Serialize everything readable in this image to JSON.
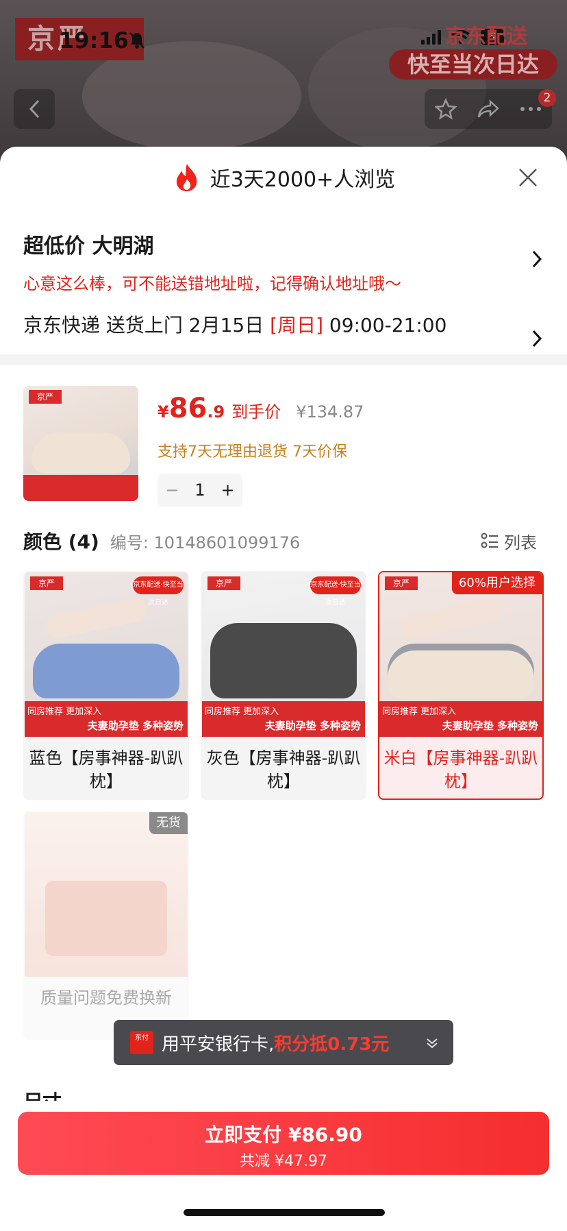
{
  "status_bar": {
    "time": "19:16",
    "battery": "5"
  },
  "header": {
    "brand_logo": "京严",
    "delivery_badge": {
      "line1": "京东配送",
      "line2": "快至当次日达"
    },
    "notification_count": "2"
  },
  "sheet": {
    "title": "近3天2000+人浏览",
    "address": {
      "name": "超低价  大明湖",
      "warning": "心意这么棒，可不能送错地址啦，记得确认地址哦～",
      "delivery_prefix": "京东快递 送货上门 2月15日 ",
      "delivery_day": "[周日]",
      "delivery_time": " 09:00-21:00"
    },
    "product": {
      "currency": "¥",
      "price_int": "86",
      "price_dec": ".9",
      "price_label": "到手价",
      "original_price": "¥134.87",
      "service": "支持7天无理由退货   7天价保",
      "quantity": "1"
    },
    "color_section": {
      "title": "颜色 (4)",
      "code": "编号: 10148601099176",
      "list_label": "列表"
    },
    "variants": [
      {
        "caption": "蓝色【房事神器-趴趴枕】",
        "selected": false,
        "pillow_color": "#7e9bd2",
        "badge": ""
      },
      {
        "caption": "灰色【房事神器-趴趴枕】",
        "selected": false,
        "pillow_color": "#4a4a4a",
        "badge": ""
      },
      {
        "caption": "米白【房事神器-趴趴枕】",
        "selected": true,
        "pillow_color": "#efe3d6",
        "badge": "60%用户选择"
      },
      {
        "caption": "质量问题免费换新",
        "selected": false,
        "pillow_color": "#f6d9d1",
        "badge": "无货"
      }
    ],
    "variant_image_text": {
      "brand": "京严",
      "delivery": "京东配送·快至当次日达",
      "banner_top": "同房推荐 更加深入",
      "banner_main": "夫妻助孕垫 多种姿势"
    },
    "size_label": "尺寸"
  },
  "toast": {
    "icon_text": "东付",
    "text_plain": "用平安银行卡,",
    "text_highlight": "积分抵0.73元"
  },
  "pay_button": {
    "main": "立即支付 ¥86.90",
    "sub": "共减 ¥47.97"
  },
  "colors": {
    "accent": "#e2231a",
    "service": "#c8801e"
  }
}
